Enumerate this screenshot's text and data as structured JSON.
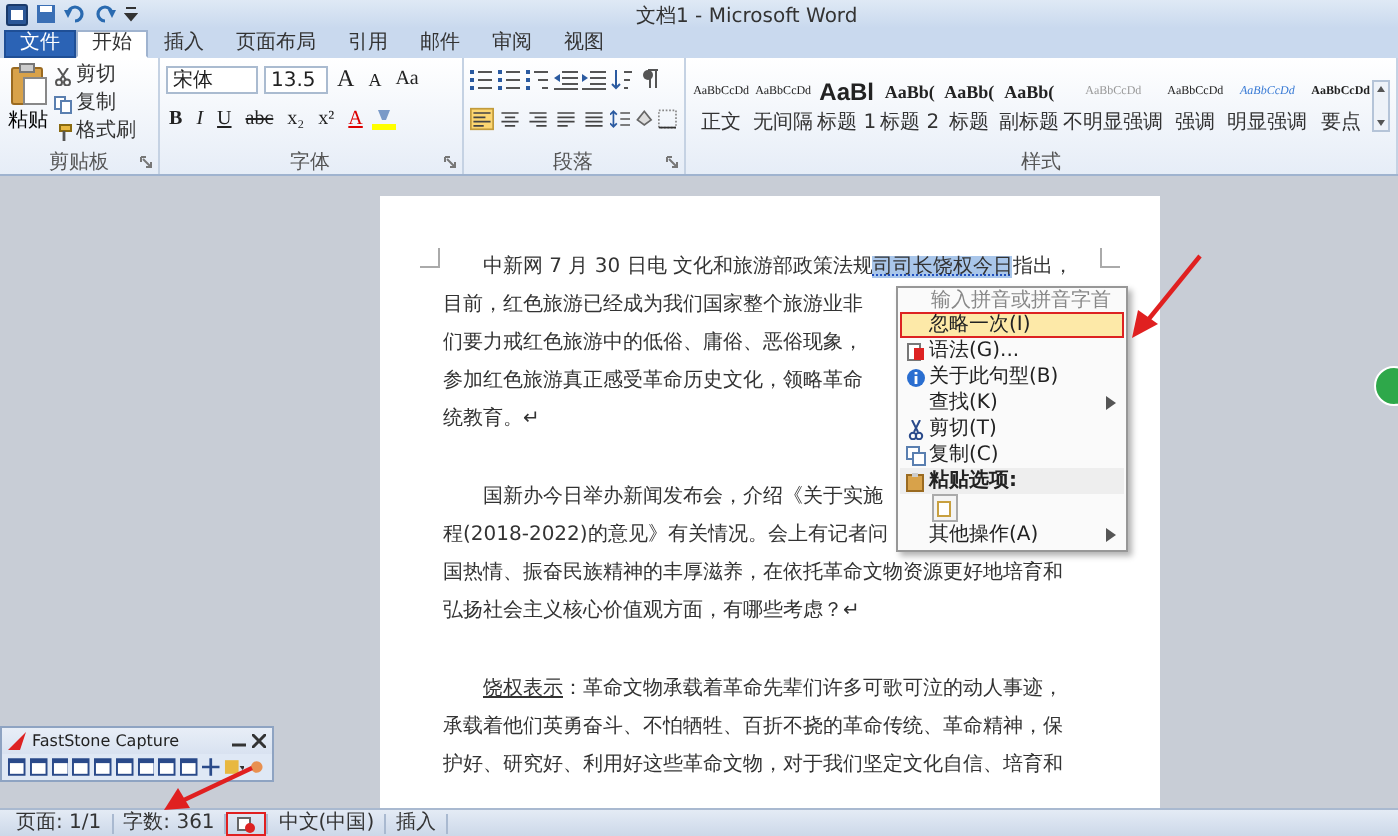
{
  "window": {
    "title": "文档1 - Microsoft Word"
  },
  "tabs": [
    {
      "label": "文件",
      "kind": "file",
      "selected": false
    },
    {
      "label": "开始",
      "kind": "tab",
      "selected": true
    },
    {
      "label": "插入",
      "kind": "tab",
      "selected": false
    },
    {
      "label": "页面布局",
      "kind": "tab",
      "selected": false
    },
    {
      "label": "引用",
      "kind": "tab",
      "selected": false
    },
    {
      "label": "邮件",
      "kind": "tab",
      "selected": false
    },
    {
      "label": "审阅",
      "kind": "tab",
      "selected": false
    },
    {
      "label": "视图",
      "kind": "tab",
      "selected": false
    }
  ],
  "clipboard": {
    "label": "剪贴板",
    "paste": "粘贴",
    "cut": "剪切",
    "copy": "复制",
    "format_painter": "格式刷"
  },
  "font": {
    "label": "字体",
    "name": "宋体",
    "size": "13.5",
    "row1_buttons": [
      {
        "text": "A",
        "kind": "grow"
      },
      {
        "text": "A",
        "kind": "shrink"
      },
      {
        "text": "Aa",
        "kind": "case"
      }
    ],
    "row2_buttons": [
      {
        "text": "B",
        "kind": "bold"
      },
      {
        "text": "I",
        "kind": "italic"
      },
      {
        "text": "U",
        "kind": "underline"
      },
      {
        "text": "abc",
        "kind": "strike"
      },
      {
        "text": "x₂",
        "kind": "sub"
      },
      {
        "text": "x²",
        "kind": "sup"
      },
      {
        "text": "A",
        "kind": "color"
      }
    ]
  },
  "paragraph": {
    "label": "段落",
    "alignments": [
      {
        "kind": "left",
        "selected": true
      },
      {
        "kind": "center",
        "selected": false
      },
      {
        "kind": "right",
        "selected": false
      },
      {
        "kind": "justify",
        "selected": false
      },
      {
        "kind": "distributed",
        "selected": false
      }
    ]
  },
  "styles": {
    "label": "样式",
    "items": [
      {
        "preview": "AaBbCcDd",
        "name": "正文",
        "kind": "normal"
      },
      {
        "preview": "AaBbCcDd",
        "name": "无间隔",
        "kind": "normal"
      },
      {
        "preview": "AaBl",
        "name": "标题 1",
        "kind": "heading1"
      },
      {
        "preview": "AaBb(",
        "name": "标题 2",
        "kind": "heading2"
      },
      {
        "preview": "AaBb(",
        "name": "标题",
        "kind": "heading2"
      },
      {
        "preview": "AaBb(",
        "name": "副标题",
        "kind": "heading2"
      },
      {
        "preview": "AaBbCcDd",
        "name": "不明显强调",
        "kind": "subtle"
      },
      {
        "preview": "AaBbCcDd",
        "name": "强调",
        "kind": "normal"
      },
      {
        "preview": "AaBbCcDd",
        "name": "明显强调",
        "kind": "intense"
      },
      {
        "preview": "AaBbCcDd",
        "name": "要点",
        "kind": "strong"
      }
    ]
  },
  "document": {
    "paragraphs": [
      {
        "lines": [
          {
            "segments": [
              {
                "text": "中新网 7 月 30 日电  文化和旅游部政策法规",
                "selected": false,
                "underlined": false
              },
              {
                "text": "司司长饶权今日",
                "selected": true,
                "underlined": false
              },
              {
                "text": "指出，",
                "selected": false,
                "underlined": false
              }
            ]
          },
          {
            "segments": [
              {
                "text": "目前，红色旅游已经成为我们国家整个旅游业非",
                "selected": false,
                "underlined": false
              }
            ]
          },
          {
            "segments": [
              {
                "text": "们要力戒红色旅游中的低俗、庸俗、恶俗现象，",
                "selected": false,
                "underlined": false
              }
            ]
          },
          {
            "segments": [
              {
                "text": "参加红色旅游真正感受革命历史文化，领略革命",
                "selected": false,
                "underlined": false
              }
            ]
          },
          {
            "segments": [
              {
                "text": "统教育。↵",
                "selected": false,
                "underlined": false
              }
            ]
          }
        ]
      },
      {
        "lines": [
          {
            "segments": [
              {
                "text": "国新办今日举办新闻发布会，介绍《关于实施",
                "selected": false,
                "underlined": false
              }
            ]
          },
          {
            "segments": [
              {
                "text": "程(2018-2022)的意见》有关情况。会上有记者问",
                "selected": false,
                "underlined": false
              }
            ]
          },
          {
            "segments": [
              {
                "text": "国热情、振奋民族精神的丰厚滋养，在依托革命文物资源更好地培育和",
                "selected": false,
                "underlined": false
              }
            ]
          },
          {
            "segments": [
              {
                "text": "弘扬社会主义核心价值观方面，有哪些考虑？↵",
                "selected": false,
                "underlined": false
              }
            ]
          }
        ]
      },
      {
        "lines": [
          {
            "segments": [
              {
                "text": "饶权表示",
                "selected": false,
                "underlined": true
              },
              {
                "text": "：革命文物承载着革命先辈们许多可歌可泣的动人事迹，",
                "selected": false,
                "underlined": false
              }
            ]
          },
          {
            "segments": [
              {
                "text": "承载着他们英勇奋斗、不怕牺牲、百折不挠的革命传统、革命精神，保",
                "selected": false,
                "underlined": false
              }
            ]
          },
          {
            "segments": [
              {
                "text": "护好、研究好、利用好这些革命文物，对于我们坚定文化自信、培育和",
                "selected": false,
                "underlined": false
              }
            ]
          }
        ]
      }
    ]
  },
  "context_menu": {
    "items": [
      {
        "kind": "hint",
        "label": "输入拼音或拼音字首"
      },
      {
        "kind": "item",
        "label": "忽略一次(I)",
        "highlighted": true,
        "outlined": true
      },
      {
        "kind": "grammar",
        "label": "语法(G)...",
        "highlighted": false,
        "outlined": false
      },
      {
        "kind": "info",
        "label": "关于此句型(B)",
        "highlighted": false,
        "outlined": false
      },
      {
        "kind": "item",
        "label": "查找(K)",
        "submenu": true,
        "highlighted": false,
        "outlined": false
      },
      {
        "kind": "cut",
        "label": "剪切(T)",
        "highlighted": false,
        "outlined": false
      },
      {
        "kind": "copy",
        "label": "复制(C)",
        "highlighted": false,
        "outlined": false
      },
      {
        "kind": "heading",
        "label": "粘贴选项:",
        "highlighted": false,
        "outlined": false
      },
      {
        "kind": "paste-option"
      },
      {
        "kind": "item",
        "label": "其他操作(A)",
        "submenu": true,
        "highlighted": false,
        "outlined": false
      }
    ]
  },
  "capture_window": {
    "title": "FastStone Capture"
  },
  "status_bar": {
    "items": [
      {
        "kind": "text",
        "text": "页面: 1/1",
        "outlined": false
      },
      {
        "kind": "text",
        "text": "字数: 361",
        "outlined": false
      },
      {
        "kind": "proofing-icon",
        "outlined": true
      },
      {
        "kind": "text",
        "text": "中文(中国)",
        "outlined": false
      },
      {
        "kind": "text",
        "text": "插入",
        "outlined": false
      }
    ]
  }
}
